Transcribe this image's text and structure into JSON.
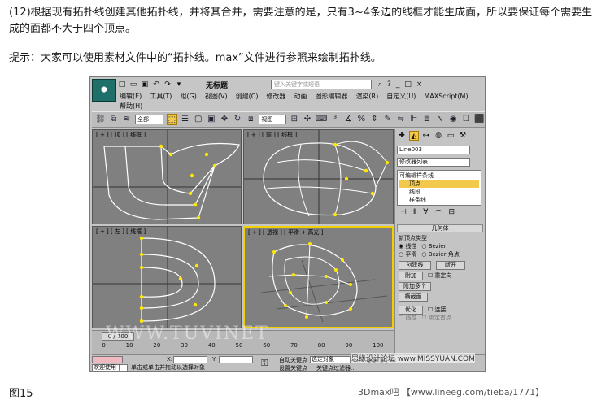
{
  "article": {
    "para1": "(12)根据现有拓扑线创建其他拓扑线，并将其合并，需要注意的是，只有3~4条边的线框才能生成面，所以要保证每个需要生成的面都不大于四个顶点。",
    "para2": "提示：大家可以使用素材文件中的“拓扑线。max”文件进行参照来绘制拓扑线。",
    "fig_label": "图15",
    "credit": "3Dmax吧 【www.lineeg.com/tieba/1771】"
  },
  "app": {
    "logo": "⬢",
    "doc_title": "无标题",
    "search_placeholder": "键入关键字或短语",
    "menus": [
      "编辑(E)",
      "工具(T)",
      "组(G)",
      "视图(V)",
      "创建(C)",
      "修改器",
      "动画",
      "图形编辑器",
      "渲染(R)",
      "自定义(U)",
      "MAXScript(M)"
    ],
    "help_menu": "帮助(H)",
    "toolbar": {
      "filter": "全部",
      "view": "视图"
    },
    "viewports": {
      "tl": "[ + ] [ 顶 ] [ 线框 ]",
      "tr": "[ + ] [ 前 ] [ 线框 ]",
      "bl": "[ + ] [ 左 ] [ 线框 ]",
      "br": "[ + ] [ 透视 ] [ 平滑 + 高光 ]"
    },
    "timeline": {
      "slider": "0 / 100",
      "ticks": [
        "0",
        "10",
        "20",
        "30",
        "40",
        "50",
        "60",
        "70",
        "80",
        "90",
        "100"
      ]
    },
    "command_panel": {
      "object_name": "Line003",
      "modifier_list": "修改器列表",
      "stack": [
        "可编辑样条线",
        "顶点",
        "线段",
        "样条线"
      ],
      "rollout_title": "几何体",
      "new_vertex_type": "新顶点类型",
      "radio": [
        "线性",
        "Bezier",
        "平滑",
        "Bezier 角点"
      ],
      "buttons": [
        "创建线",
        "断开",
        "附加",
        "重定向",
        "附加多个",
        "横截面",
        "优化",
        "连接",
        "线性",
        "绑定首点"
      ]
    },
    "status": {
      "welcome": "欢迎使用 |",
      "message": "单击或单击并拖动以选择对象",
      "x_label": "X:",
      "y_label": "Y:",
      "autokey": "自动关键点",
      "selection": "选定对象",
      "setkey": "设置关键点",
      "keyfilter": "关键点过滤器..."
    },
    "watermarks": {
      "site": "WWW.TUVINET",
      "forum": "思缘设计论坛 www.MISSYUAN.COM"
    }
  }
}
